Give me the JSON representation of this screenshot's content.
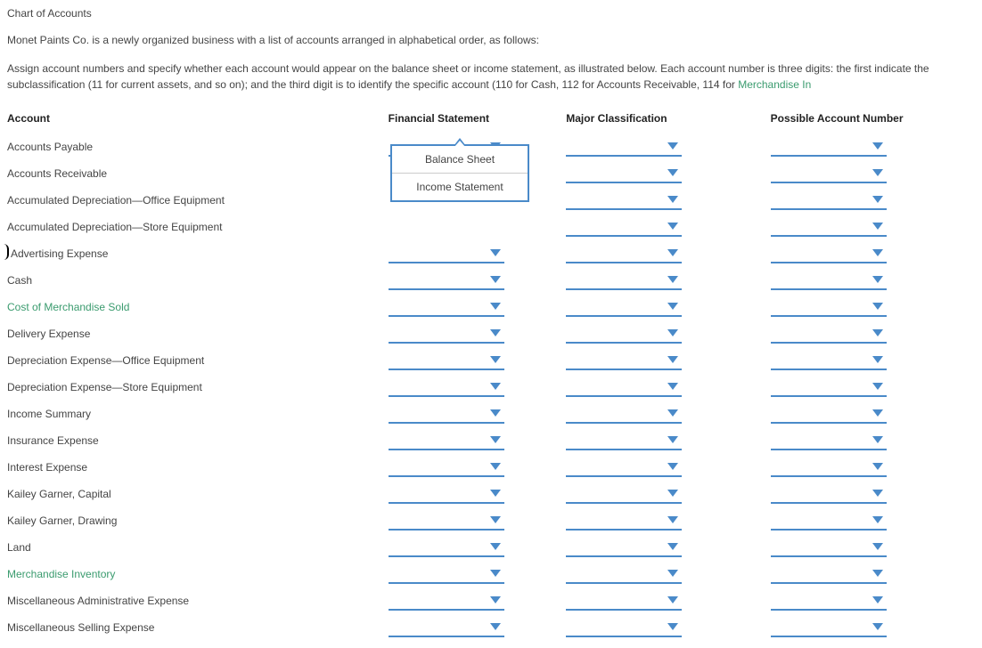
{
  "title": "Chart of Accounts",
  "intro": "Monet Paints Co. is a newly organized business with a list of accounts arranged in alphabetical order, as follows:",
  "instructions_prefix": "Assign account numbers and specify whether each account would appear on the balance sheet or income statement, as illustrated below. Each account number is three digits: the first indicate the subclassification (11 for current assets, and so on); and the third digit is to identify the specific account (110 for Cash, 112 for Accounts Receivable, 114 for ",
  "instructions_link": "Merchandise In",
  "headers": {
    "account": "Account",
    "financial": "Financial Statement",
    "major": "Major Classification",
    "number": "Possible Account Number"
  },
  "dropdown_open": {
    "row_index": 0,
    "column": "financial",
    "options": [
      "Balance Sheet",
      "Income Statement"
    ]
  },
  "accounts": [
    {
      "name": "Accounts Payable",
      "green": false
    },
    {
      "name": "Accounts Receivable",
      "green": false
    },
    {
      "name": "Accumulated Depreciation—Office Equipment",
      "green": false
    },
    {
      "name": "Accumulated Depreciation—Store Equipment",
      "green": false
    },
    {
      "name": "Advertising Expense",
      "green": false,
      "cursor": true
    },
    {
      "name": "Cash",
      "green": false
    },
    {
      "name": "Cost of Merchandise Sold",
      "green": true
    },
    {
      "name": "Delivery Expense",
      "green": false
    },
    {
      "name": "Depreciation Expense—Office Equipment",
      "green": false
    },
    {
      "name": "Depreciation Expense—Store Equipment",
      "green": false
    },
    {
      "name": "Income Summary",
      "green": false
    },
    {
      "name": "Insurance Expense",
      "green": false
    },
    {
      "name": "Interest Expense",
      "green": false
    },
    {
      "name": "Kailey Garner, Capital",
      "green": false
    },
    {
      "name": "Kailey Garner, Drawing",
      "green": false
    },
    {
      "name": "Land",
      "green": false
    },
    {
      "name": "Merchandise Inventory",
      "green": true
    },
    {
      "name": "Miscellaneous Administrative Expense",
      "green": false
    },
    {
      "name": "Miscellaneous Selling Expense",
      "green": false
    }
  ]
}
